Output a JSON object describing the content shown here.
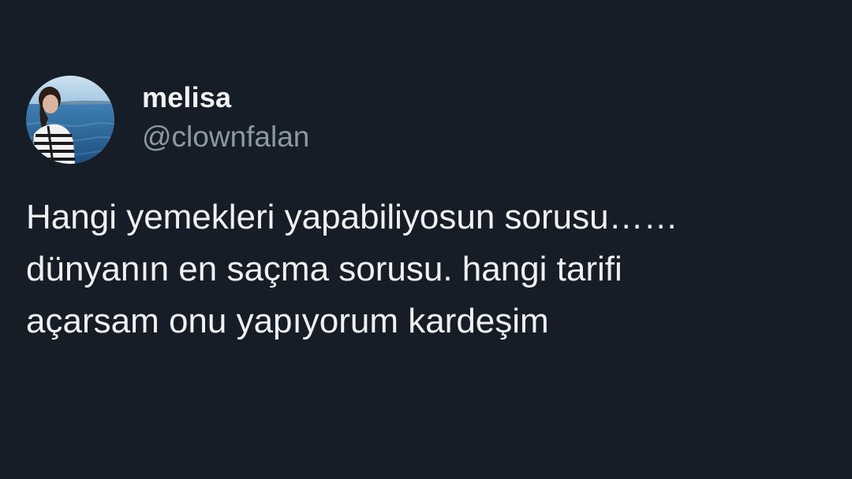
{
  "tweet": {
    "author": {
      "display_name": "melisa",
      "handle": "@clownfalan",
      "avatar_icon": "profile-photo"
    },
    "text_lines": [
      "Hangi yemekleri yapabiliyosun sorusu……",
      "dünyanın en saçma sorusu. hangi tarifi",
      "açarsam onu yapıyorum kardeşim"
    ]
  },
  "colors": {
    "background": "#161d27",
    "primary_text": "#eef0f1",
    "secondary_text": "#8b98a5"
  }
}
